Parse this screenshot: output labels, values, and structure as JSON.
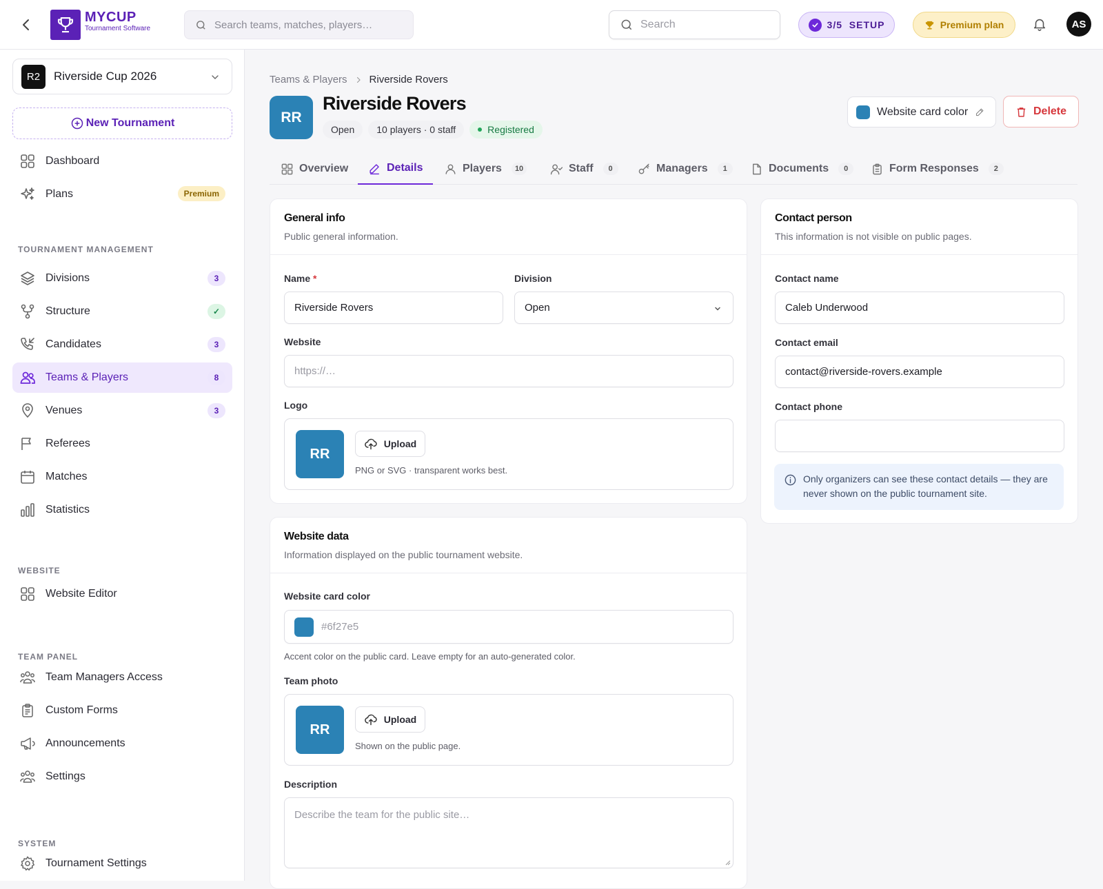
{
  "app": {
    "logo_main": "MYCUP",
    "logo_sub": "Tournament Software"
  },
  "topbar": {
    "global_search_placeholder": "Search teams, matches, players…",
    "search_placeholder": "Search",
    "setup_label": "3/5  SETUP",
    "premium_label": "Premium plan",
    "avatar_initials": "AS"
  },
  "sidebar": {
    "tournament_badge": "R2",
    "tournament_name": "Riverside Cup 2026",
    "new_tournament": "New Tournament",
    "top_items": [
      {
        "label": "Dashboard"
      },
      {
        "label": "Plans",
        "badge": "Premium"
      }
    ],
    "sections": {
      "management": "TOURNAMENT MANAGEMENT",
      "website": "WEBSITE",
      "team_panel": "TEAM PANEL",
      "system": "SYSTEM"
    },
    "management_items": [
      {
        "label": "Divisions",
        "count": "3"
      },
      {
        "label": "Structure",
        "count": "✓"
      },
      {
        "label": "Candidates",
        "count": "3"
      },
      {
        "label": "Teams & Players",
        "count": "8"
      },
      {
        "label": "Venues",
        "count": "3"
      },
      {
        "label": "Referees"
      },
      {
        "label": "Matches"
      },
      {
        "label": "Statistics"
      }
    ],
    "website_items": [
      {
        "label": "Website Editor"
      }
    ],
    "team_panel_items": [
      {
        "label": "Team Managers Access"
      },
      {
        "label": "Custom Forms"
      },
      {
        "label": "Announcements"
      },
      {
        "label": "Settings"
      }
    ],
    "system_items": [
      {
        "label": "Tournament Settings"
      }
    ]
  },
  "breadcrumb": {
    "parent": "Teams & Players",
    "current": "Riverside Rovers"
  },
  "team": {
    "initials": "RR",
    "name": "Riverside Rovers",
    "division_chip": "Open",
    "roster_chip": "10 players · 0 staff",
    "status_chip": "Registered",
    "card_color_button": "Website card color",
    "delete_button": "Delete",
    "card_color": "#2b82b5"
  },
  "tabs": [
    {
      "label": "Overview"
    },
    {
      "label": "Details"
    },
    {
      "label": "Players",
      "count": "10"
    },
    {
      "label": "Staff",
      "count": "0"
    },
    {
      "label": "Managers",
      "count": "1"
    },
    {
      "label": "Documents",
      "count": "0"
    },
    {
      "label": "Form Responses",
      "count": "2"
    }
  ],
  "general": {
    "title": "General info",
    "subtitle": "Public general information.",
    "name_label": "Name",
    "name_value": "Riverside Rovers",
    "division_label": "Division",
    "division_value": "Open",
    "website_label": "Website",
    "website_placeholder": "https://…",
    "logo_label": "Logo",
    "logo_initials": "RR",
    "upload_label": "Upload",
    "logo_hint": "PNG or SVG · transparent works best."
  },
  "website_data": {
    "title": "Website data",
    "subtitle": "Information displayed on the public tournament website.",
    "color_label": "Website card color",
    "color_value": "#6f27e5",
    "color_hint": "Accent color on the public card. Leave empty for an auto-generated color.",
    "photo_label": "Team photo",
    "photo_initials": "RR",
    "upload_label": "Upload",
    "photo_hint": "Shown on the public page.",
    "description_label": "Description",
    "description_placeholder": "Describe the team for the public site…"
  },
  "contact": {
    "title": "Contact person",
    "subtitle": "This information is not visible on public pages.",
    "name_label": "Contact name",
    "name_value": "Caleb Underwood",
    "email_label": "Contact email",
    "email_value": "contact@riverside-rovers.example",
    "phone_label": "Contact phone",
    "phone_value": "",
    "note": "Only organizers can see these contact details — they are never shown on the public tournament site."
  }
}
